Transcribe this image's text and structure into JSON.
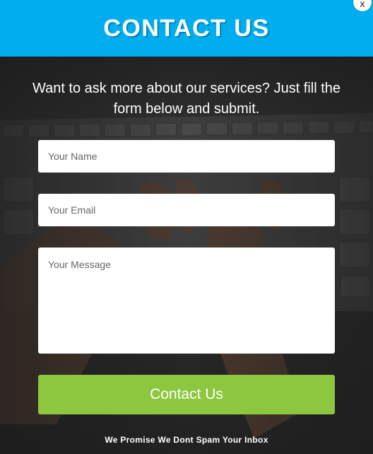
{
  "header": {
    "title": "CONTACT US",
    "close_label": "x",
    "background_color": "#00aeef"
  },
  "intro": {
    "text": "Want to ask more about our services? Just fill the form below and submit."
  },
  "form": {
    "name_placeholder": "Your Name",
    "email_placeholder": "Your Email",
    "message_placeholder": "Your Message",
    "submit_label": "Contact Us",
    "submit_color": "#8dc63f"
  },
  "footer": {
    "promise_text": "We Promise We Dont Spam Your Inbox"
  },
  "background": {
    "image": "keyboard-typing-hands-photo",
    "overlay_color": "#3c3c3c"
  }
}
